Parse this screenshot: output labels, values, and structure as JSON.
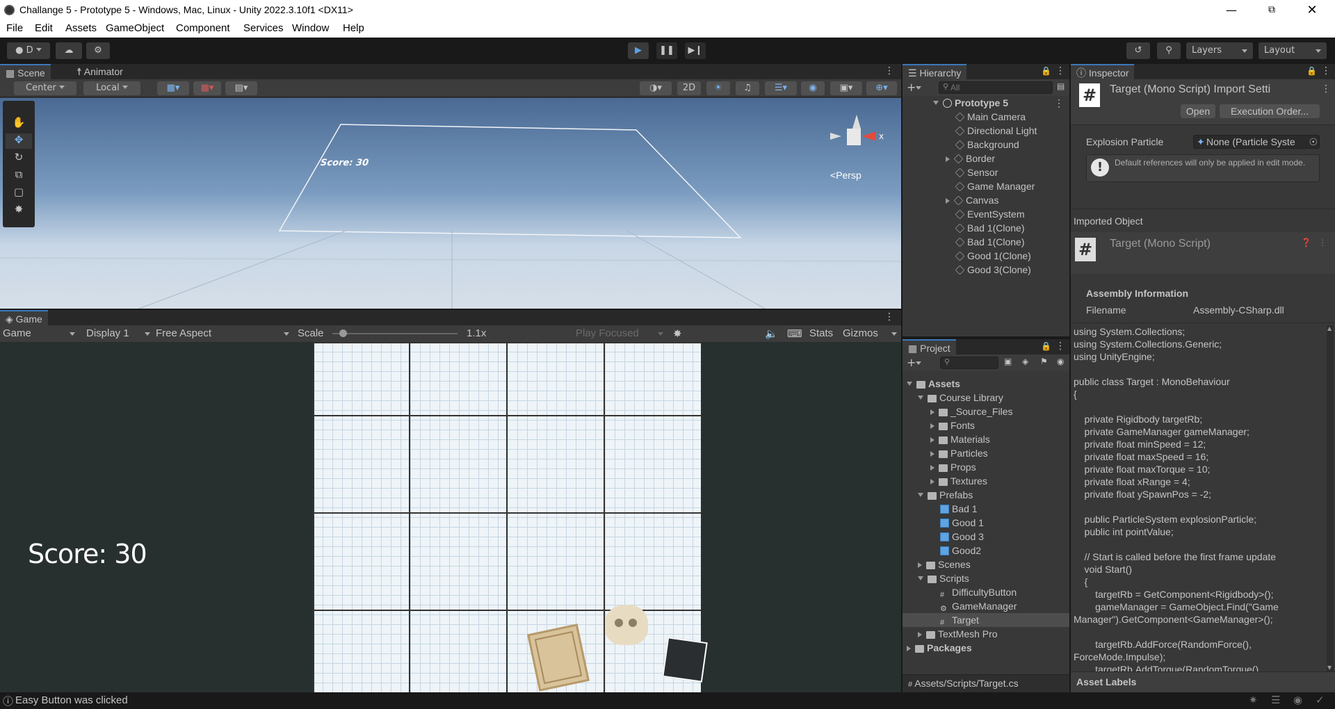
{
  "window": {
    "title": "Challange 5 - Prototype 5 - Windows, Mac, Linux - Unity 2022.3.10f1 <DX11>"
  },
  "menu": [
    "File",
    "Edit",
    "Assets",
    "GameObject",
    "Component",
    "Services",
    "Window",
    "Help"
  ],
  "toolbar": {
    "account": "D",
    "layers": "Layers",
    "layout": "Layout"
  },
  "scene": {
    "tabs": [
      "Scene",
      "Animator"
    ],
    "pivot": "Center",
    "space": "Local",
    "mode2d": "2D",
    "persp": "Persp",
    "axis_x": "x",
    "score_text": "Score: 30"
  },
  "game": {
    "tab": "Game",
    "display_mode": "Game",
    "display": "Display 1",
    "aspect": "Free Aspect",
    "scale_label": "Scale",
    "scale_value": "1.1x",
    "play_focused": "Play Focused",
    "stats": "Stats",
    "gizmos": "Gizmos",
    "score_text": "Score: 30"
  },
  "hierarchy": {
    "tab": "Hierarchy",
    "search_placeholder": "All",
    "scene_name": "Prototype 5",
    "items": [
      "Main Camera",
      "Directional Light",
      "Background",
      "Border",
      "Sensor",
      "Game Manager",
      "Canvas",
      "EventSystem",
      "Bad 1(Clone)",
      "Bad 1(Clone)",
      "Good 1(Clone)",
      "Good 3(Clone)"
    ]
  },
  "project": {
    "tab": "Project",
    "assets": "Assets",
    "course_library": "Course Library",
    "course_children": [
      "_Source_Files",
      "Fonts",
      "Materials",
      "Particles",
      "Props",
      "Textures"
    ],
    "prefabs": "Prefabs",
    "prefab_children": [
      "Bad 1",
      "Good 1",
      "Good 3",
      "Good2"
    ],
    "scenes": "Scenes",
    "scripts": "Scripts",
    "script_children": [
      "DifficultyButton",
      "GameManager",
      "Target"
    ],
    "textmesh": "TextMesh Pro",
    "packages": "Packages",
    "path": "Assets/Scripts/Target.cs"
  },
  "inspector": {
    "tab": "Inspector",
    "header_title": "Target (Mono Script) Import Setti",
    "open": "Open",
    "execution_order": "Execution Order...",
    "field_label": "Explosion Particle",
    "field_value": "None (Particle Syste",
    "help_text": "Default references will only be applied in edit mode.",
    "imported_object": "Imported Object",
    "imported_title": "Target (Mono Script)",
    "assembly_info": "Assembly Information",
    "filename_label": "Filename",
    "filename_value": "Assembly-CSharp.dll",
    "code": "using System.Collections;\nusing System.Collections.Generic;\nusing UnityEngine;\n\npublic class Target : MonoBehaviour\n{\n\n    private Rigidbody targetRb;\n    private GameManager gameManager;\n    private float minSpeed = 12;\n    private float maxSpeed = 16;\n    private float maxTorque = 10;\n    private float xRange = 4;\n    private float ySpawnPos = -2;\n\n    public ParticleSystem explosionParticle;\n    public int pointValue;\n\n    // Start is called before the first frame update\n    void Start()\n    {\n        targetRb = GetComponent<Rigidbody>();\n        gameManager = GameObject.Find(\"Game\nManager\").GetComponent<GameManager>();\n\n        targetRb.AddForce(RandomForce(),\nForceMode.Impulse);\n        targetRb.AddTorque(RandomTorque()",
    "asset_labels": "Asset Labels"
  },
  "status": {
    "message": "Easy Button was clicked"
  },
  "colors": {
    "accent": "#3a79bb",
    "sky_top": "#4a6a94",
    "sky_bottom": "#c7d6e6"
  }
}
